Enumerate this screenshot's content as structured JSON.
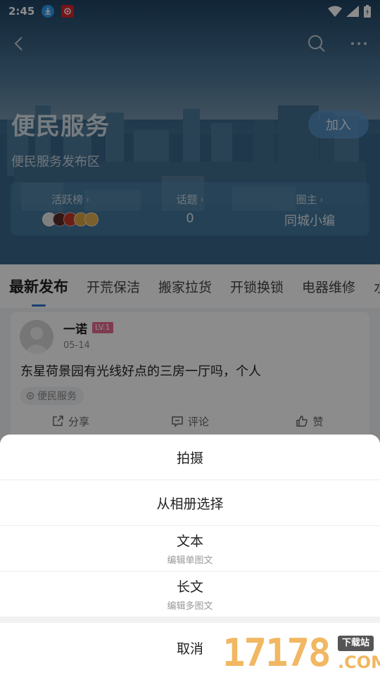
{
  "status_bar": {
    "time": "2:45"
  },
  "header": {
    "title": "便民服务",
    "description": "便民服务发布区",
    "join_label": "加入"
  },
  "stats": [
    {
      "label": "活跃榜",
      "value": ""
    },
    {
      "label": "话题",
      "value": "0"
    },
    {
      "label": "圈主",
      "value": "同城小编"
    }
  ],
  "tabs": [
    "最新发布",
    "开荒保洁",
    "搬家拉货",
    "开锁换锁",
    "电器维修",
    "水"
  ],
  "post": {
    "author": "一诺",
    "level": "LV.1",
    "date": "05-14",
    "text": "东星荷景园有光线好点的三房一厅吗，个人",
    "tag": "便民服务",
    "actions": {
      "share": "分享",
      "comment": "评论",
      "like": "赞"
    }
  },
  "action_sheet": {
    "items": [
      {
        "label": "拍摄",
        "sub": ""
      },
      {
        "label": "从相册选择",
        "sub": ""
      },
      {
        "label": "文本",
        "sub": "编辑单图文"
      },
      {
        "label": "长文",
        "sub": "编辑多图文"
      }
    ],
    "cancel": "取消"
  },
  "watermark": {
    "digits": "17178",
    "badge": "下载站",
    "suffix": ".COM"
  },
  "colors": {
    "accent": "#2f74d0",
    "level_badge": "#e86c8e"
  }
}
